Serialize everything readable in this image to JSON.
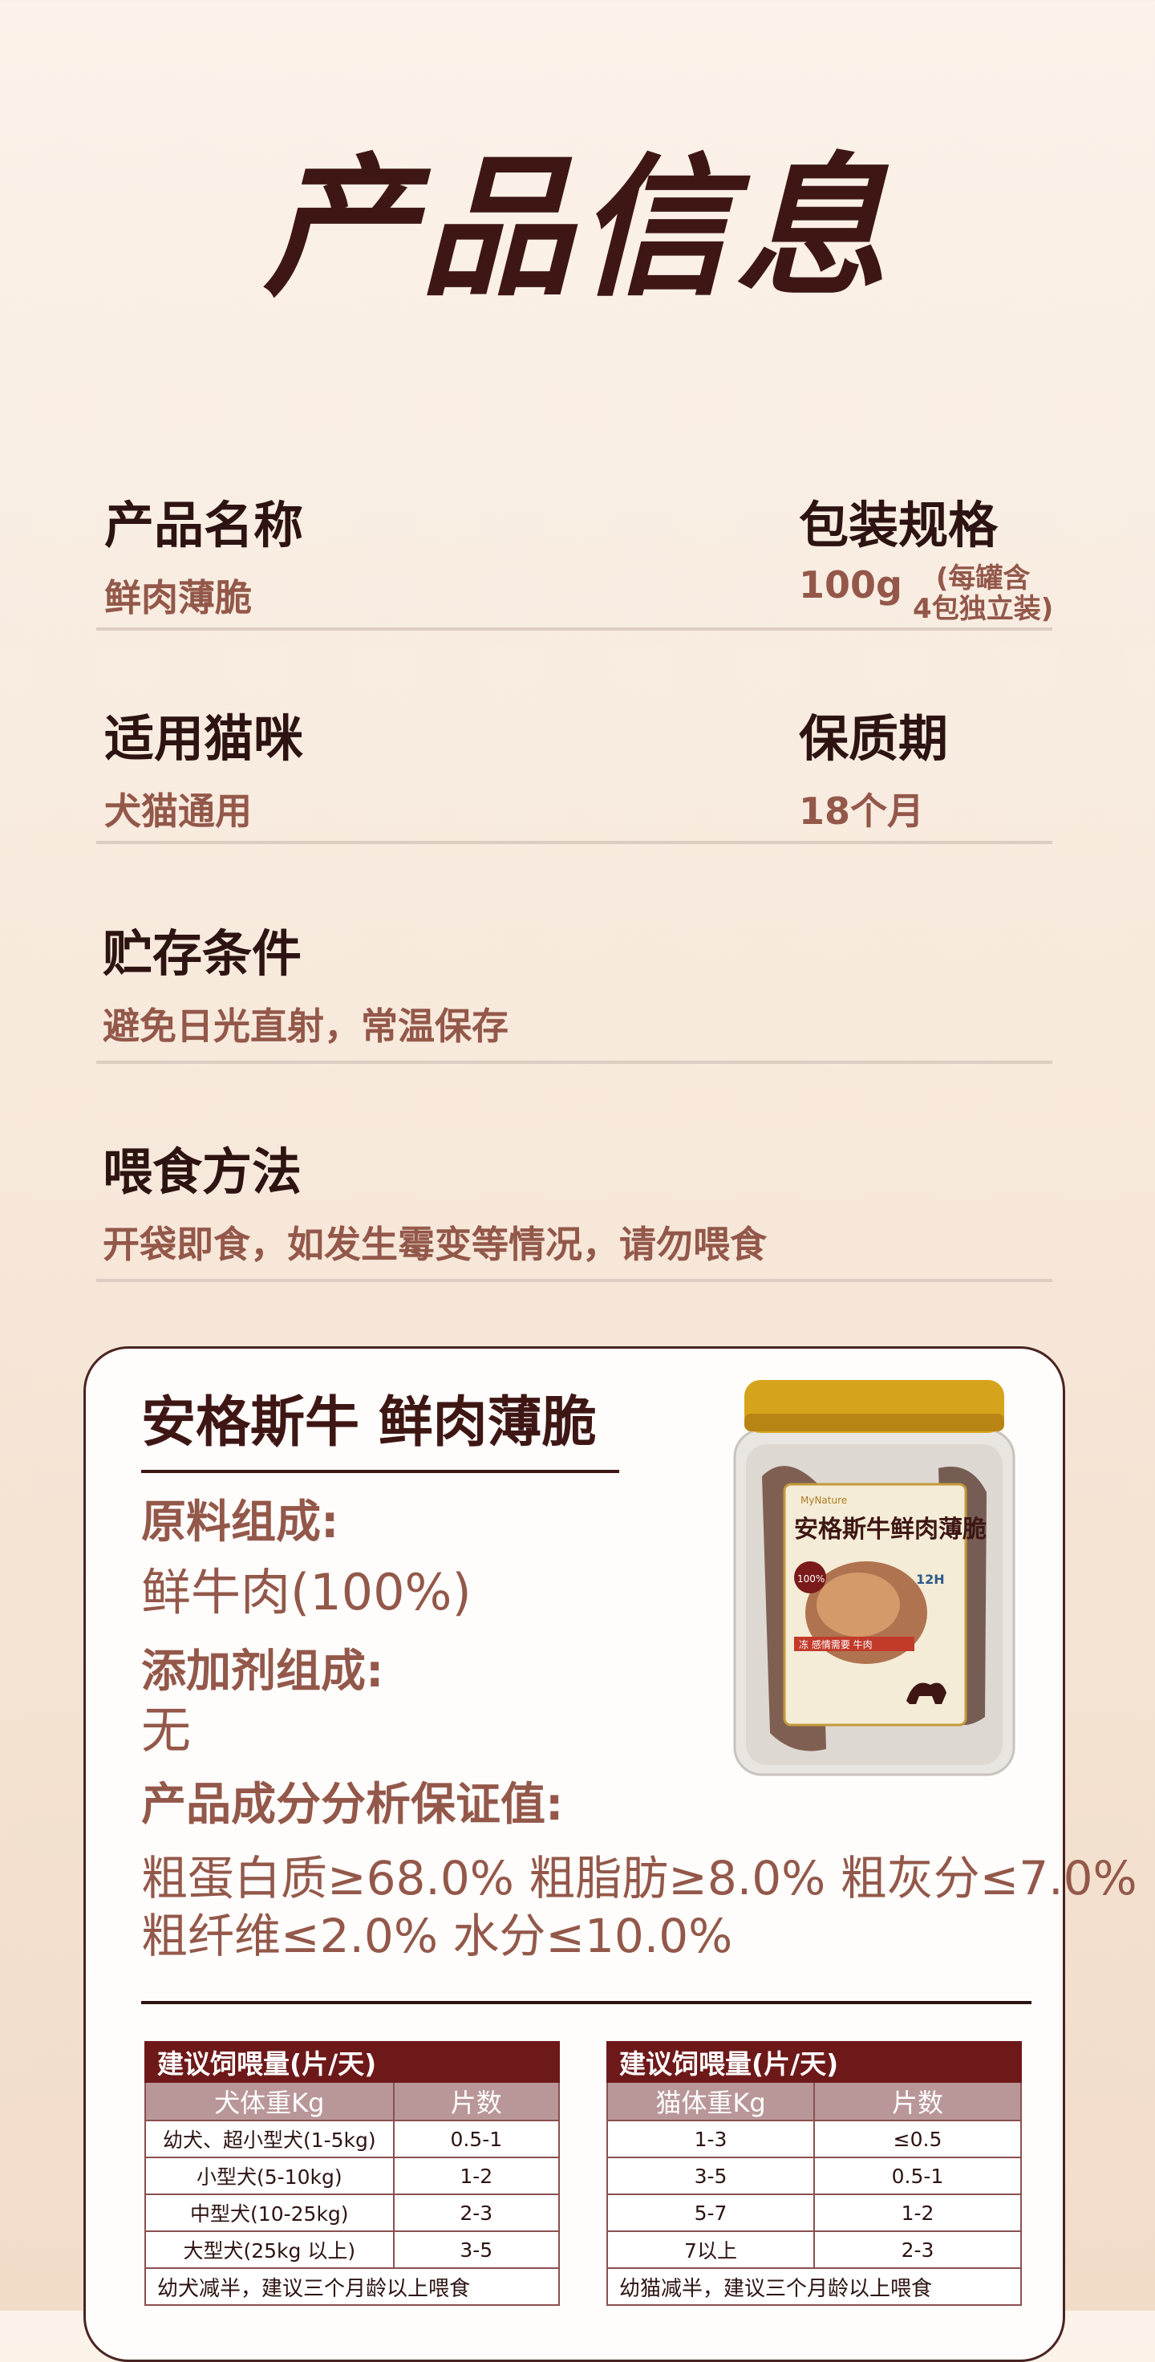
{
  "title": "产品信息",
  "info": {
    "name_label": "产品名称",
    "name_value": "鲜肉薄脆",
    "spec_label": "包装规格",
    "spec_value": "100g",
    "spec_note_line1": "(每罐含",
    "spec_note_line2": "4包独立装)",
    "suit_label": "适用猫咪",
    "suit_value": "犬猫通用",
    "shelf_label": "保质期",
    "shelf_value": "18个月",
    "storage_label": "贮存条件",
    "storage_value": "避免日光直射，常温保存",
    "feed_label": "喂食方法",
    "feed_value": "开袋即食，如发生霉变等情况，请勿喂食"
  },
  "card": {
    "title": "安格斯牛 鲜肉薄脆",
    "ingredients_label": "原料组成:",
    "ingredients_value": "鲜牛肉(100%)",
    "additive_label": "添加剂组成:",
    "additive_value": "无",
    "analysis_label": "产品成分分析保证值:",
    "analysis_line1": "粗蛋白质≥68.0%   粗脂肪≥8.0%   粗灰分≤7.0%",
    "analysis_line2": "粗纤维≤2.0%   水分≤10.0%"
  },
  "jar": {
    "brand": "MyNature",
    "label_title": "安格斯牛鲜肉薄脆",
    "badge_pct": "100%",
    "badge_12h": "12H",
    "ribbon": "冻 感情需要 牛肉"
  },
  "dog_table": {
    "header": "建议饲喂量(片/天)",
    "col1": "犬体重Kg",
    "col2": "片数",
    "rows": [
      [
        "幼犬、超小型犬(1-5kg)",
        "0.5-1"
      ],
      [
        "小型犬(5-10kg)",
        "1-2"
      ],
      [
        "中型犬(10-25kg)",
        "2-3"
      ],
      [
        "大型犬(25kg 以上)",
        "3-5"
      ]
    ],
    "note": "幼犬减半，建议三个月龄以上喂食"
  },
  "cat_table": {
    "header": "建议饲喂量(片/天)",
    "col1": "猫体重Kg",
    "col2": "片数",
    "rows": [
      [
        "1-3",
        "≤0.5"
      ],
      [
        "3-5",
        "0.5-1"
      ],
      [
        "5-7",
        "1-2"
      ],
      [
        "7以上",
        "2-3"
      ]
    ],
    "note": "幼猫减半，建议三个月龄以上喂食"
  },
  "colors": {
    "heading": "#3e1715",
    "value": "#93584a",
    "table_header": "#6e1919",
    "table_colhead": "#b99799"
  }
}
